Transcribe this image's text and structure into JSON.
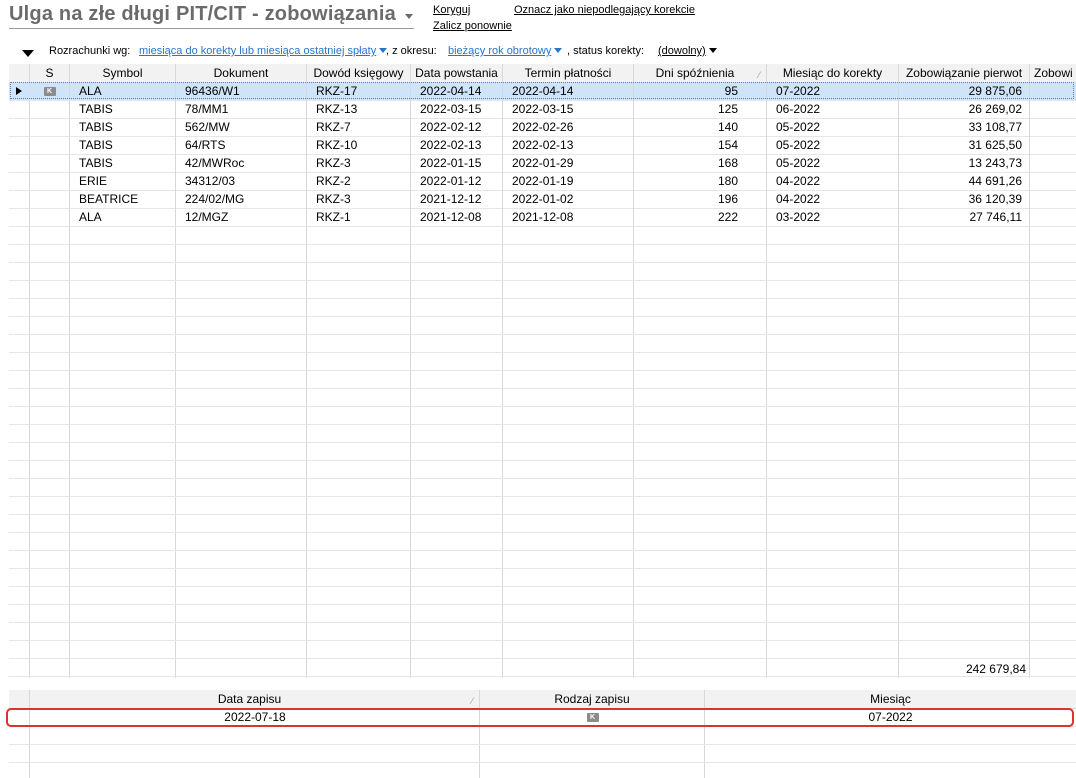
{
  "header": {
    "title": "Ulga na złe długi PIT/CIT - zobowiązania",
    "actions": {
      "koryguj": "Koryguj",
      "zalicz_ponownie": "Zalicz ponownie",
      "oznacz": "Oznacz jako niepodlegający korekcie"
    }
  },
  "filters": {
    "rozrachunki_label": "Rozrachunki wg:",
    "rozrachunki_value": "miesiąca do korekty lub miesiąca ostatniej spłaty",
    "okres_label": ", z okresu:",
    "okres_value": "bieżący rok obrotowy",
    "status_label": ", status korekty:",
    "status_value": "(dowolny)"
  },
  "table": {
    "columns": [
      "S",
      "Symbol",
      "Dokument",
      "Dowód księgowy",
      "Data powstania",
      "Termin płatności",
      "Dni spóźnienia",
      "Miesiąc do korekty",
      "Zobowiązanie pierwot",
      "Zobowi"
    ],
    "rows": [
      {
        "s": "K",
        "symbol": "ALA",
        "dokument": "96436/W1",
        "dowod": "RKZ-17",
        "data_powstania": "2022-04-14",
        "termin": "2022-04-14",
        "dni": "95",
        "miesiac": "07-2022",
        "zobowiazanie": "29 875,06"
      },
      {
        "s": "",
        "symbol": "TABIS",
        "dokument": "78/MM1",
        "dowod": "RKZ-13",
        "data_powstania": "2022-03-15",
        "termin": "2022-03-15",
        "dni": "125",
        "miesiac": "06-2022",
        "zobowiazanie": "26 269,02"
      },
      {
        "s": "",
        "symbol": "TABIS",
        "dokument": "562/MW",
        "dowod": "RKZ-7",
        "data_powstania": "2022-02-12",
        "termin": "2022-02-26",
        "dni": "140",
        "miesiac": "05-2022",
        "zobowiazanie": "33 108,77"
      },
      {
        "s": "",
        "symbol": "TABIS",
        "dokument": "64/RTS",
        "dowod": "RKZ-10",
        "data_powstania": "2022-02-13",
        "termin": "2022-02-13",
        "dni": "154",
        "miesiac": "05-2022",
        "zobowiazanie": "31 625,50"
      },
      {
        "s": "",
        "symbol": "TABIS",
        "dokument": "42/MWRoc",
        "dowod": "RKZ-3",
        "data_powstania": "2022-01-15",
        "termin": "2022-01-29",
        "dni": "168",
        "miesiac": "05-2022",
        "zobowiazanie": "13 243,73"
      },
      {
        "s": "",
        "symbol": "ERIE",
        "dokument": "34312/03",
        "dowod": "RKZ-2",
        "data_powstania": "2022-01-12",
        "termin": "2022-01-19",
        "dni": "180",
        "miesiac": "04-2022",
        "zobowiazanie": "44 691,26"
      },
      {
        "s": "",
        "symbol": "BEATRICE",
        "dokument": "224/02/MG",
        "dowod": "RKZ-3",
        "data_powstania": "2021-12-12",
        "termin": "2022-01-02",
        "dni": "196",
        "miesiac": "04-2022",
        "zobowiazanie": "36 120,39"
      },
      {
        "s": "",
        "symbol": "ALA",
        "dokument": "12/MGZ",
        "dowod": "RKZ-1",
        "data_powstania": "2021-12-08",
        "termin": "2021-12-08",
        "dni": "222",
        "miesiac": "03-2022",
        "zobowiazanie": "27 746,11"
      }
    ],
    "total": "242 679,84"
  },
  "detail": {
    "columns": [
      "Data zapisu",
      "Rodzaj zapisu",
      "Miesiąc"
    ],
    "rows": [
      {
        "data": "2022-07-18",
        "rodzaj": "K",
        "miesiac": "07-2022"
      }
    ]
  },
  "colors": {
    "selection": "#cfe4f8",
    "link": "#2a74c8",
    "highlight": "#e03030"
  }
}
